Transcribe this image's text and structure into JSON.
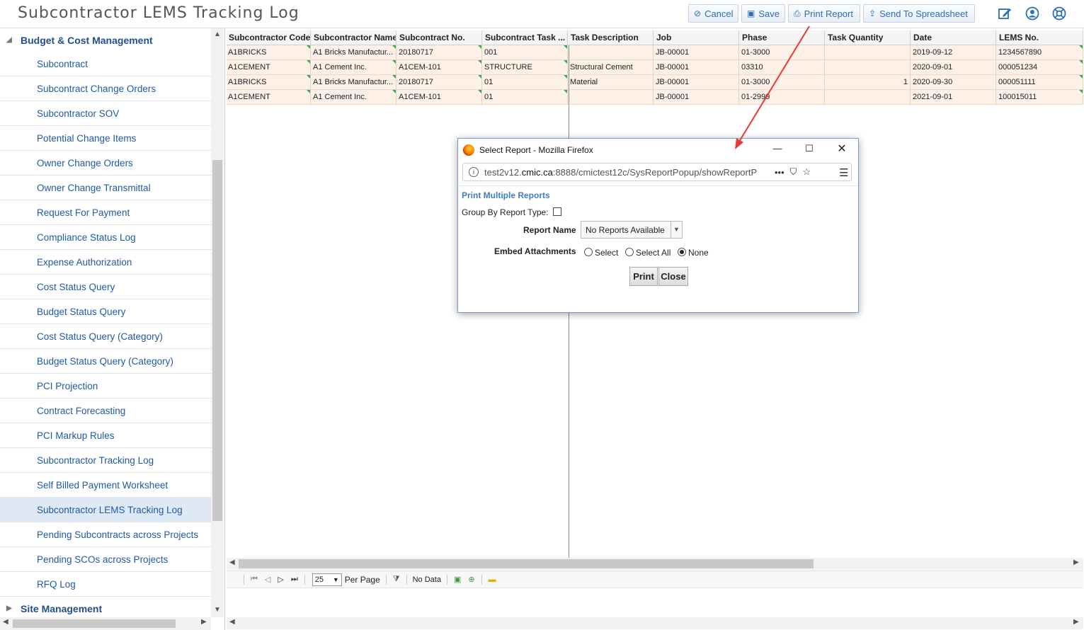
{
  "header": {
    "title": "Subcontractor LEMS Tracking Log",
    "buttons": {
      "cancel": "Cancel",
      "save": "Save",
      "print_report": "Print Report",
      "send_to_spreadsheet": "Send To Spreadsheet"
    },
    "icons": [
      "edit-icon",
      "user-icon",
      "help-icon"
    ]
  },
  "sidebar": {
    "category_top": "Budget & Cost Management",
    "items": [
      {
        "label": "Subcontract"
      },
      {
        "label": "Subcontract Change Orders"
      },
      {
        "label": "Subcontractor SOV"
      },
      {
        "label": "Potential Change Items"
      },
      {
        "label": "Owner Change Orders"
      },
      {
        "label": "Owner Change Transmittal"
      },
      {
        "label": "Request For Payment"
      },
      {
        "label": "Compliance Status Log"
      },
      {
        "label": "Expense Authorization"
      },
      {
        "label": "Cost Status Query"
      },
      {
        "label": "Budget Status Query"
      },
      {
        "label": "Cost Status Query (Category)"
      },
      {
        "label": "Budget Status Query (Category)"
      },
      {
        "label": "PCI Projection"
      },
      {
        "label": "Contract Forecasting"
      },
      {
        "label": "PCI Markup Rules"
      },
      {
        "label": "Subcontractor Tracking Log"
      },
      {
        "label": "Self Billed Payment Worksheet"
      },
      {
        "label": "Subcontractor LEMS Tracking Log",
        "active": true
      },
      {
        "label": "Pending Subcontracts across Projects"
      },
      {
        "label": "Pending SCOs across Projects"
      },
      {
        "label": "RFQ Log"
      }
    ],
    "category_bottom": "Site Management"
  },
  "grid": {
    "columns": [
      "Subcontractor Code",
      "Subcontractor Name",
      "Subcontract No.",
      "Subcontract Task ...",
      "Task Description",
      "Job",
      "Phase",
      "Task Quantity",
      "Date",
      "LEMS No."
    ],
    "rows": [
      [
        "A1BRICKS",
        "A1 Bricks Manufactur...",
        "20180717",
        "001",
        "",
        "JB-00001",
        "01-3000",
        "",
        "2019-09-12",
        "1234567890"
      ],
      [
        "A1CEMENT",
        "A1 Cement Inc.",
        "A1CEM-101",
        "STRUCTURE",
        "Structural Cement",
        "JB-00001",
        "03310",
        "",
        "2020-09-01",
        "000051234"
      ],
      [
        "A1BRICKS",
        "A1 Bricks Manufactur...",
        "20180717",
        "01",
        "Material",
        "JB-00001",
        "01-3000",
        "1",
        "2020-09-30",
        "000051111"
      ],
      [
        "A1CEMENT",
        "A1 Cement Inc.",
        "A1CEM-101",
        "01",
        "",
        "JB-00001",
        "01-2999",
        "",
        "2021-09-01",
        "100015011"
      ]
    ]
  },
  "pager": {
    "page_size": "25",
    "per_page_label": "Per Page",
    "status": "No Data"
  },
  "dialog": {
    "window_title": "Select Report - Mozilla Firefox",
    "url_prefix": "test2v12.",
    "url_domain": "cmic.ca",
    "url_rest": ":8888/cmictest12c/SysReportPopup/showReportP",
    "url_more": "•••",
    "section_title": "Print Multiple Reports",
    "group_by_label": "Group By Report Type:",
    "report_name_label": "Report Name",
    "report_name_value": "No Reports Available",
    "embed_label": "Embed Attachments",
    "radio_select": "Select",
    "radio_select_all": "Select All",
    "radio_none": "None",
    "selected_embed_option": "None",
    "print_button": "Print",
    "close_button": "Close"
  },
  "colors": {
    "accent": "#2a6ebb",
    "row_bg": "#fdf1e7",
    "active_item_bg": "#dfe9f5",
    "annotation_arrow": "#e53935",
    "cell_flag": "#2fb24a"
  }
}
